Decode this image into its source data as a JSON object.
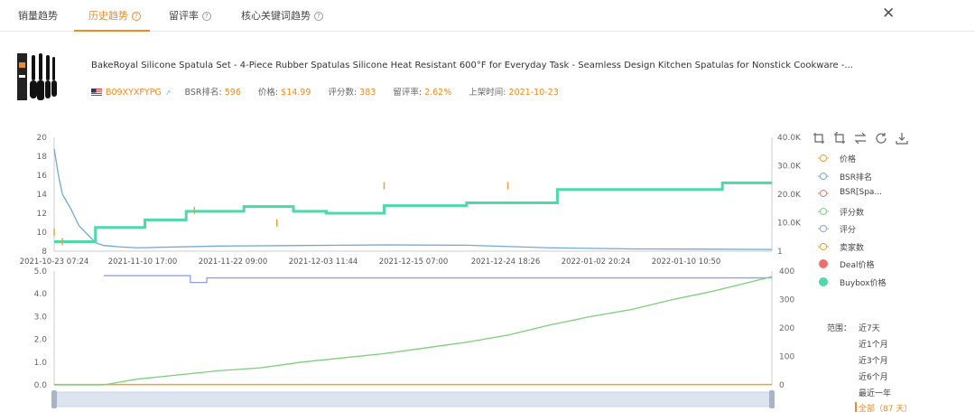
{
  "tabs": [
    {
      "label": "销量趋势",
      "help": false
    },
    {
      "label": "历史趋势",
      "help": true,
      "active": true
    },
    {
      "label": "留评率",
      "help": true
    },
    {
      "label": "核心关键词趋势",
      "help": true
    }
  ],
  "close_icon": "close-icon",
  "product": {
    "title": "BakeRoyal Silicone Spatula Set - 4-Piece Rubber Spatulas Silicone Heat Resistant 600°F for Everyday Task - Seamless Design Kitchen Spatulas for Nonstick Cookware -...",
    "asin": "B09XYXFYPG",
    "bsr_label": "BSR排名:",
    "bsr": "596",
    "price_label": "价格:",
    "price": "$14.99",
    "reviews_label": "评分数:",
    "reviews": "383",
    "review_rate_label": "留评率:",
    "review_rate": "2.62%",
    "launch_label": "上架时间:",
    "launch": "2021-10-23",
    "flag": "us-flag-icon"
  },
  "toolbar_icons": [
    "zoom-icon",
    "zoom-reset-icon",
    "switch-icon",
    "refresh-icon",
    "download-icon"
  ],
  "legend": [
    {
      "label": "价格",
      "color": "#f0a030",
      "style": "ring"
    },
    {
      "label": "BSR排名",
      "color": "#6fa8dc",
      "style": "ring"
    },
    {
      "label": "BSR[Spa...",
      "color": "#e07b7b",
      "style": "ring"
    },
    {
      "label": "评分数",
      "color": "#7ad07a",
      "style": "ring"
    },
    {
      "label": "评分",
      "color": "#8fa0e8",
      "style": "ring"
    },
    {
      "label": "卖家数",
      "color": "#f0a030",
      "style": "ring"
    },
    {
      "label": "Deal价格",
      "color": "#ee6e6e",
      "style": "dot"
    },
    {
      "label": "Buybox价格",
      "color": "#4fd8a8",
      "style": "dot"
    }
  ],
  "range": {
    "label": "范围：",
    "options": [
      "近7天",
      "近1个月",
      "近3个月",
      "近6个月",
      "最近一年",
      "全部（87 天）"
    ],
    "active_index": 5
  },
  "chart_data": [
    {
      "type": "line",
      "x_ticks": [
        "2021-10-23 07:24",
        "2021-11-10 17:00",
        "2021-11-22 09:00",
        "2021-12-03 11:44",
        "2021-12-15 07:00",
        "2021-12-24 18:26",
        "2022-01-02 20:24",
        "2022-01-10 10:50"
      ],
      "y_left_ticks": [
        "8",
        "10",
        "12",
        "14",
        "16",
        "18",
        "20"
      ],
      "y_right_ticks": [
        "1",
        "10.0K",
        "20.0K",
        "30.0K",
        "40.0K"
      ],
      "ylim_left": [
        8,
        20
      ],
      "ylim_right": [
        1,
        40000
      ],
      "series": [
        {
          "name": "Buybox价格",
          "axis": "left",
          "color": "#4fd8a8",
          "x": [
            0,
            4,
            5,
            10,
            11,
            15,
            16,
            22,
            23,
            28,
            29,
            30,
            33,
            34,
            40,
            41,
            50,
            51,
            61,
            62,
            80,
            81,
            87
          ],
          "values": [
            9.0,
            9.0,
            10.5,
            10.5,
            11.3,
            11.3,
            12.2,
            12.2,
            12.7,
            12.7,
            12.2,
            12.2,
            12.0,
            12.0,
            12.8,
            12.8,
            13.1,
            13.1,
            14.5,
            14.5,
            14.5,
            15.2,
            15.2
          ]
        },
        {
          "name": "价格",
          "axis": "left",
          "color": "#f0a030",
          "x": [
            0,
            1,
            17,
            27,
            40,
            55
          ],
          "values": [
            10.0,
            9.0,
            12.3,
            11.0,
            14.9,
            14.9
          ]
        },
        {
          "name": "BSR排名",
          "axis": "right",
          "color": "#6fa8dc",
          "x": [
            0,
            0.5,
            1,
            2,
            3,
            4,
            5,
            6,
            8,
            10,
            20,
            30,
            40,
            50,
            60,
            70,
            80,
            87
          ],
          "values": [
            36000,
            27000,
            20000,
            15000,
            9000,
            6000,
            3000,
            2000,
            1500,
            1200,
            1800,
            2000,
            2200,
            2100,
            1200,
            800,
            700,
            600
          ]
        }
      ]
    },
    {
      "type": "line",
      "y_left_ticks": [
        "0.0",
        "1.0",
        "2.0",
        "3.0",
        "4.0",
        "5.0"
      ],
      "y_right_ticks": [
        "0",
        "100",
        "200",
        "300",
        "400"
      ],
      "ylim_left": [
        0,
        5
      ],
      "ylim_right": [
        0,
        400
      ],
      "series": [
        {
          "name": "评分数",
          "axis": "right",
          "color": "#7ad07a",
          "x": [
            0,
            6,
            10,
            15,
            20,
            25,
            30,
            35,
            40,
            45,
            50,
            55,
            60,
            65,
            70,
            75,
            80,
            87
          ],
          "values": [
            0,
            0,
            20,
            35,
            50,
            60,
            80,
            95,
            110,
            130,
            150,
            175,
            210,
            240,
            265,
            300,
            330,
            380
          ]
        },
        {
          "name": "评分",
          "axis": "left",
          "color": "#8fa0e8",
          "x": [
            6,
            16,
            16.5,
            18,
            18.5,
            87
          ],
          "values": [
            4.8,
            4.8,
            4.5,
            4.5,
            4.7,
            4.7
          ]
        },
        {
          "name": "卖家数",
          "axis": "right",
          "color": "#f0a030",
          "x": [
            0,
            87
          ],
          "values": [
            1,
            1
          ]
        }
      ]
    }
  ]
}
